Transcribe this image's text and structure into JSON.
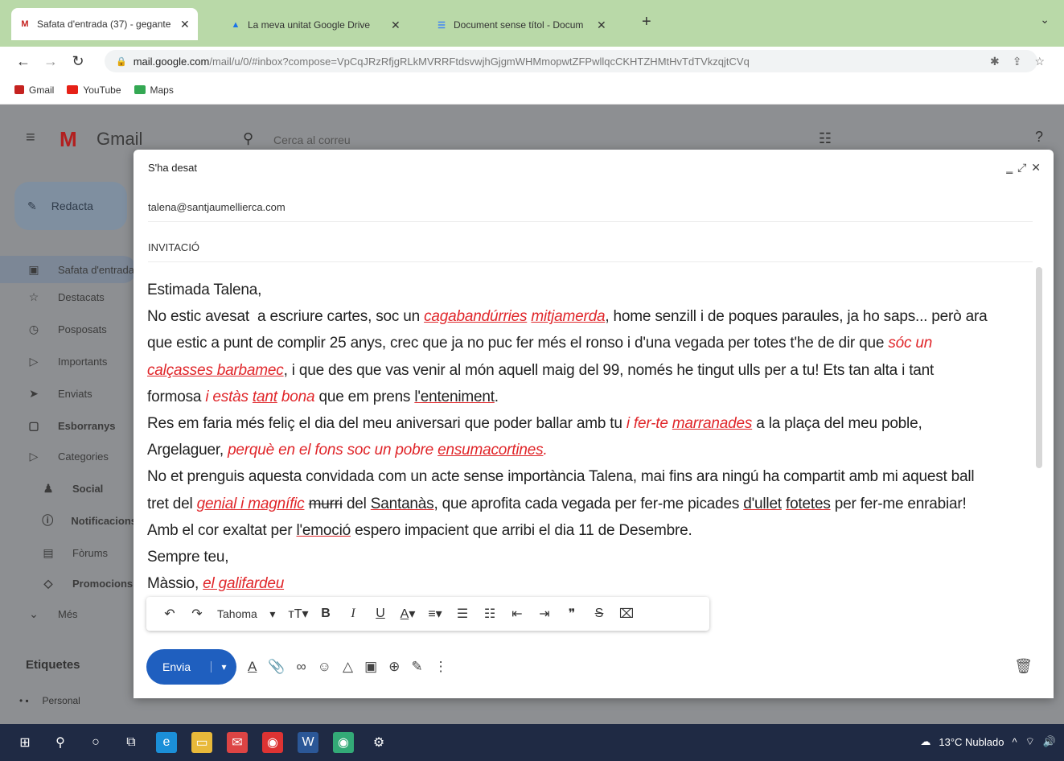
{
  "browser": {
    "tabs": [
      {
        "label": "Safata d'entrada (37) - gegante",
        "favicon": "M",
        "favicon_color": "#c5221f"
      },
      {
        "label": "La meva unitat Google Drive",
        "favicon": "▲",
        "favicon_color": "#1a73e8"
      },
      {
        "label": "Document sense títol - Docum",
        "favicon": "☰",
        "favicon_color": "#4285f4"
      }
    ],
    "close": "✕",
    "new_tab": "+",
    "tab_menu": "⌄",
    "url_host": "mail.google.com",
    "url_rest": "/mail/u/0/#inbox?compose=VpCqJRzRfjgRLkMVRRFtdsvwjhGjgmWHMmopwtZFPwllqcCKHTZHMtHvTdTVkzqjtCVq",
    "bookmarks": [
      "Gmail",
      "YouTube",
      "Maps"
    ]
  },
  "gmail": {
    "logo": "M",
    "wordmark": "Gmail",
    "search_placeholder": "Cerca al correu",
    "compose_label": "Redacta",
    "nav": [
      {
        "label": "Safata d'entrada",
        "icon": "▣"
      },
      {
        "label": "Destacats",
        "icon": "☆"
      },
      {
        "label": "Posposats",
        "icon": "◷"
      },
      {
        "label": "Importants",
        "icon": "▷"
      },
      {
        "label": "Enviats",
        "icon": "➤"
      },
      {
        "label": "Esborranys",
        "icon": "▢"
      },
      {
        "label": "Categories",
        "icon": "▷"
      },
      {
        "label": "Social",
        "icon": "♟"
      },
      {
        "label": "Notificacions",
        "icon": "ⓘ"
      },
      {
        "label": "Fòrums",
        "icon": "▤"
      },
      {
        "label": "Promocions",
        "icon": "◇"
      },
      {
        "label": "Més",
        "icon": "⌄"
      }
    ],
    "labels_heading": "Etiquetes",
    "label_personal": "Personal"
  },
  "compose": {
    "status": "S'ha desat",
    "to": "talena@santjaumellierca.com",
    "subject": "INVITACIÓ",
    "greeting": "Estimada Talena,",
    "signature_name": "Màssio,",
    "signature_nick": "el galifardeu",
    "closing": "Sempre teu,",
    "font": "Tahoma",
    "send_label": "Envia"
  },
  "taskbar": {
    "weather": "13°C Nublado"
  },
  "colors": {
    "accent": "#1f5fbf",
    "highlight_red": "#e0262a",
    "tab_bar": "#b9d9a8"
  }
}
